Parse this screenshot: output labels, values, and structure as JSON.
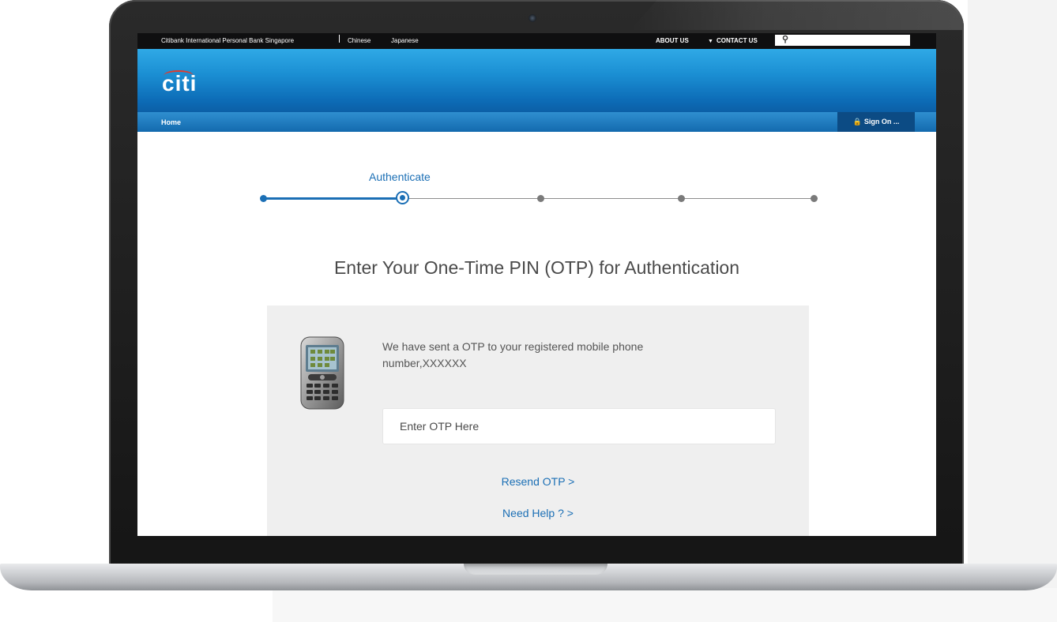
{
  "topbar": {
    "site_name": "Citibank International Personal Bank Singapore",
    "languages": [
      "Chinese",
      "Japanese"
    ],
    "about_us": "ABOUT US",
    "contact_us": "CONTACT US",
    "search_icon": "search-icon"
  },
  "header": {
    "logo_text": "citi"
  },
  "navbar": {
    "home": "Home",
    "sign_on": "Sign On ...",
    "lock_icon": "lock-icon"
  },
  "progress": {
    "current_label": "Authenticate",
    "total_steps": 5,
    "current_step": 2
  },
  "main": {
    "heading": "Enter Your One-Time PIN (OTP) for Authentication",
    "message": "We have sent a OTP to your registered mobile phone number,XXXXXX",
    "otp_placeholder": "Enter OTP Here",
    "resend": "Resend OTP >",
    "help": "Need Help ? >"
  },
  "colors": {
    "link": "#1b6fb5",
    "header": "#1b8fd3",
    "signon": "#0c4b84"
  }
}
